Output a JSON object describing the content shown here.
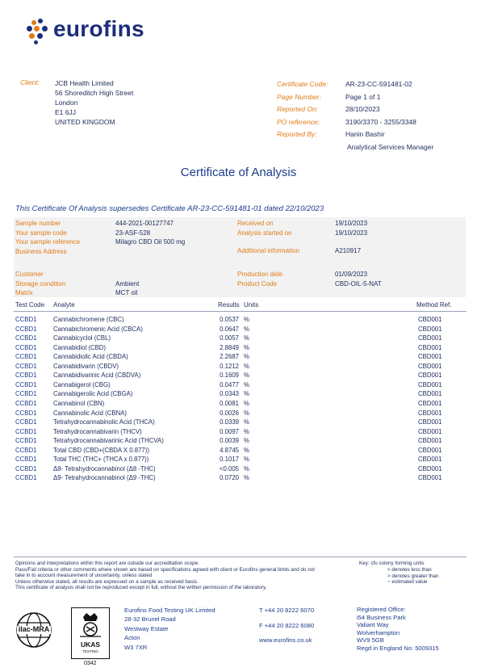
{
  "brand": {
    "name": "eurofins"
  },
  "client": {
    "label": "Client:",
    "lines": [
      "JCB Health Limited",
      "56 Shoreditch High Street",
      "London",
      "E1 6JJ",
      "UNITED KINGDOM"
    ]
  },
  "certificate": {
    "fields": [
      {
        "label": "Certificate Code:",
        "value": "AR-23-CC-591481-02"
      },
      {
        "label": "Page Number:",
        "value": "Page 1 of 1"
      },
      {
        "label": "Reported On:",
        "value": "28/10/2023"
      },
      {
        "label": "PO reference:",
        "value": "3190/3370 - 3255/3348"
      },
      {
        "label": "Reported By:",
        "value": "Hanin Bashir"
      }
    ],
    "reporter_role": "Analytical Services Manager"
  },
  "title": "Certificate of Analysis",
  "supersedes": "This Certificate Of Analysis supersedes Certificate AR-23-CC-591481-01 dated 22/10/2023",
  "sample": {
    "left": [
      {
        "label": "Sample number",
        "value": "444-2021-00127747"
      },
      {
        "label": "Your sample code",
        "value": "23-ASF-528"
      },
      {
        "label": "Your sample reference",
        "value": "Milagro CBD Oil 500 mg"
      },
      {
        "label": "Business Address",
        "value": ""
      },
      {
        "label": "Customer",
        "value": ""
      },
      {
        "label": "Storage condition",
        "value": "Ambient"
      },
      {
        "label": "Matrix",
        "value": "MCT oil"
      }
    ],
    "right": [
      {
        "label": "Received on",
        "value": "19/10/2023"
      },
      {
        "label": "Analysis started on",
        "value": "19/10/2023"
      },
      {
        "label": "Additional information",
        "value": "A210917"
      },
      {
        "label": "Production date",
        "value": "01/09/2023"
      },
      {
        "label": "Product Code",
        "value": "CBD-OIL-5-NAT"
      }
    ]
  },
  "table": {
    "headers": {
      "code": "Test Code",
      "analyte": "Analyte",
      "results": "Results",
      "units": "Units",
      "method": "Method Ref."
    },
    "rows": [
      {
        "code": "CCBD1",
        "analyte": "Cannabichromene (CBC)",
        "result": "0.0537",
        "unit": "%",
        "method": "CBD001"
      },
      {
        "code": "CCBD1",
        "analyte": "Cannabichromenic Acid (CBCA)",
        "result": "0.0647",
        "unit": "%",
        "method": "CBD001"
      },
      {
        "code": "CCBD1",
        "analyte": "Cannabicyclol (CBL)",
        "result": "0.0057",
        "unit": "%",
        "method": "CBD001"
      },
      {
        "code": "CCBD1",
        "analyte": "Cannabidiol (CBD)",
        "result": "2.8849",
        "unit": "%",
        "method": "CBD001"
      },
      {
        "code": "CCBD1",
        "analyte": "Cannabidiolic Acid (CBDA)",
        "result": "2.2687",
        "unit": "%",
        "method": "CBD001"
      },
      {
        "code": "CCBD1",
        "analyte": "Cannabidivarin (CBDV)",
        "result": "0.1212",
        "unit": "%",
        "method": "CBD001"
      },
      {
        "code": "CCBD1",
        "analyte": "Cannabidivarinic Acid (CBDVA)",
        "result": "0.1609",
        "unit": "%",
        "method": "CBD001"
      },
      {
        "code": "CCBD1",
        "analyte": "Cannabigerol (CBG)",
        "result": "0.0477",
        "unit": "%",
        "method": "CBD001"
      },
      {
        "code": "CCBD1",
        "analyte": "Cannabigerolic Acid (CBGA)",
        "result": "0.0343",
        "unit": "%",
        "method": "CBD001"
      },
      {
        "code": "CCBD1",
        "analyte": "Cannabinol (CBN)",
        "result": "0.0081",
        "unit": "%",
        "method": "CBD001"
      },
      {
        "code": "CCBD1",
        "analyte": "Cannabinolic Acid (CBNA)",
        "result": "0.0026",
        "unit": "%",
        "method": "CBD001"
      },
      {
        "code": "CCBD1",
        "analyte": "Tetrahydrocannabinolic Acid (THCA)",
        "result": "0.0339",
        "unit": "%",
        "method": "CBD001"
      },
      {
        "code": "CCBD1",
        "analyte": "Tetrahydrocannabivarin (THCV)",
        "result": "0.0097",
        "unit": "%",
        "method": "CBD001"
      },
      {
        "code": "CCBD1",
        "analyte": "Tetrahydrocannabivarinic Acid (THCVA)",
        "result": "0.0039",
        "unit": "%",
        "method": "CBD001"
      },
      {
        "code": "CCBD1",
        "analyte": "Total CBD (CBD+(CBDA X 0.877))",
        "result": "4.8745",
        "unit": "%",
        "method": "CBD001"
      },
      {
        "code": "CCBD1",
        "analyte": "Total THC (THC+ (THCA x 0.877))",
        "result": "0.1017",
        "unit": "%",
        "method": "CBD001"
      },
      {
        "code": "CCBD1",
        "analyte": "Δ8- Tetrahydrocannabinol (Δ8 -THC)",
        "result": "<0.005",
        "unit": "%",
        "method": "CBD001"
      },
      {
        "code": "CCBD1",
        "analyte": "Δ9- Tetrahydrocannabinol (Δ9 -THC)",
        "result": "0.0720",
        "unit": "%",
        "method": "CBD001"
      }
    ]
  },
  "footer": {
    "notes": [
      "Opinions and interpretations within this report are outside our accreditation scope.",
      "Pass/Fail criteria or other comments where shown are based on specifications agreed with client or Eurofins general limits and do not",
      "take in to account measurement of uncertainty, unless stated",
      "Unless otherwise stated, all results are expressed on a sample as received basis.",
      "This certificate of analysis shall not be reproduced except in full, without the written permission of the laboratory."
    ],
    "key": [
      "Key: cfu colony forming units",
      "< denotes less than",
      "> denotes greater than",
      "~ estimated value"
    ],
    "company_lines": [
      "Eurofins Food Testing UK Limited",
      "28-32 Brunel Road",
      "Westway Estate",
      "Acton",
      "W3 7XR"
    ],
    "contact": {
      "tel": "T  +44 20 8222 6070",
      "fax": "F  +44 20 8222 6080",
      "web": "www.eurofins.co.uk"
    },
    "registered_lines": [
      "Registered Office:",
      "i54 Business Park",
      "Valiant Way",
      "Wolverhampton",
      "WV9 5GB",
      "Regd in England No: 5009315"
    ],
    "ilac_label": "ilac-MRA",
    "ukas_label": "UKAS",
    "ukas_sub": "TESTING",
    "ukas_number": "0342"
  }
}
